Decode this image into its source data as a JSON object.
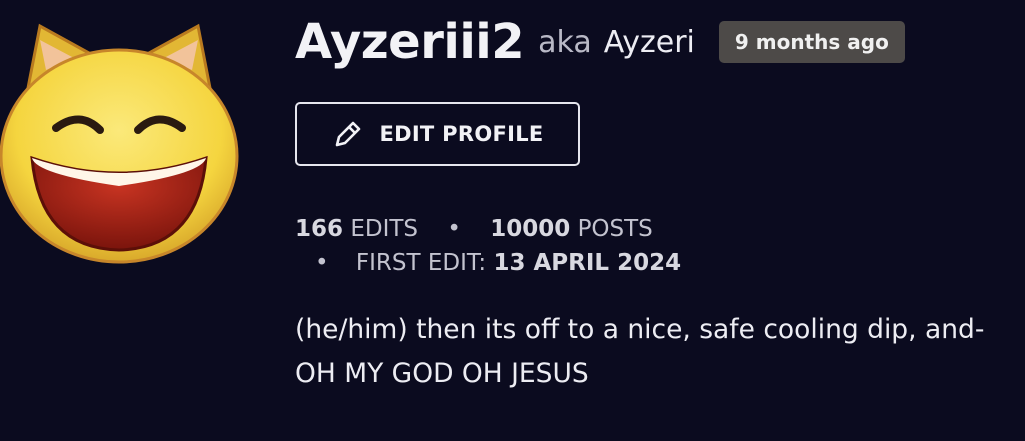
{
  "profile": {
    "username": "Ayzeriii2",
    "aka_label": "aka",
    "alias": "Ayzeri",
    "joined": "9 months ago",
    "edit_label": "EDIT PROFILE",
    "avatar_icon": "laughing-cat-emoji-icon"
  },
  "stats": {
    "edits_count": "166",
    "edits_label": "EDITS",
    "posts_count": "10000",
    "posts_label": "POSTS",
    "separator": "•",
    "first_edit_label": "FIRST EDIT:",
    "first_edit_date": "13 APRIL 2024"
  },
  "bio": {
    "text": "(he/him) then its off to a nice, safe cooling dip, and- OH MY GOD OH JESUS"
  },
  "colors": {
    "background": "#0b0b1f",
    "badge": "#4d4a48",
    "avatar_face": "#f7dc4f",
    "avatar_mouth": "#9c1d12"
  }
}
